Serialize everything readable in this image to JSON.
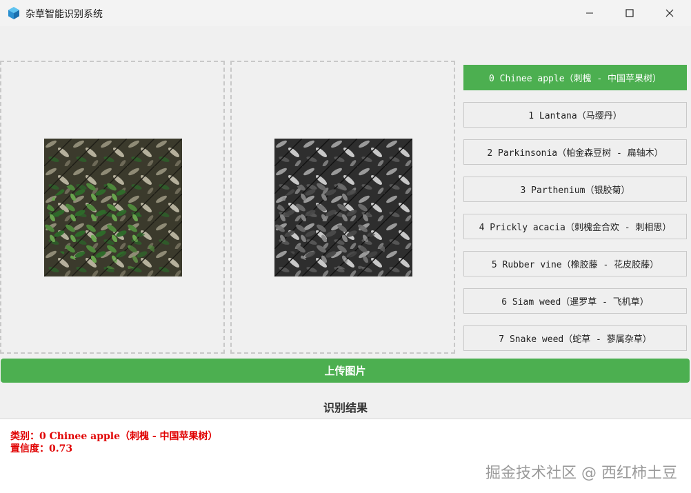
{
  "window": {
    "title": "杂草智能识别系统",
    "icons": {
      "app": "cube-icon",
      "minimize": "minimize-icon",
      "maximize": "maximize-icon",
      "close": "close-icon"
    }
  },
  "images": {
    "original": "weed-photo-color",
    "processed": "weed-photo-grayscale"
  },
  "classes": [
    {
      "label": "0 Chinee apple（刺槐 - 中国苹果树）",
      "active": true
    },
    {
      "label": "1 Lantana（马缨丹）",
      "active": false
    },
    {
      "label": "2 Parkinsonia（帕金森豆树 - 扁轴木）",
      "active": false
    },
    {
      "label": "3 Parthenium（银胶菊）",
      "active": false
    },
    {
      "label": "4 Prickly acacia（刺槐金合欢 - 刺相思）",
      "active": false
    },
    {
      "label": "5 Rubber vine（橡胶藤 - 花皮胶藤）",
      "active": false
    },
    {
      "label": "6 Siam weed（暹罗草 - 飞机草）",
      "active": false
    },
    {
      "label": "7 Snake weed（蛇草 - 蓼属杂草）",
      "active": false
    }
  ],
  "upload_label": "上传图片",
  "result": {
    "title": "识别结果",
    "category_line": "类别：0 Chinee apple（刺槐 - 中国苹果树）",
    "confidence_line": "置信度：0.73"
  },
  "watermark": "掘金技术社区 @ 西红柿土豆",
  "colors": {
    "accent": "#4caf50",
    "result_text": "#e00000"
  }
}
